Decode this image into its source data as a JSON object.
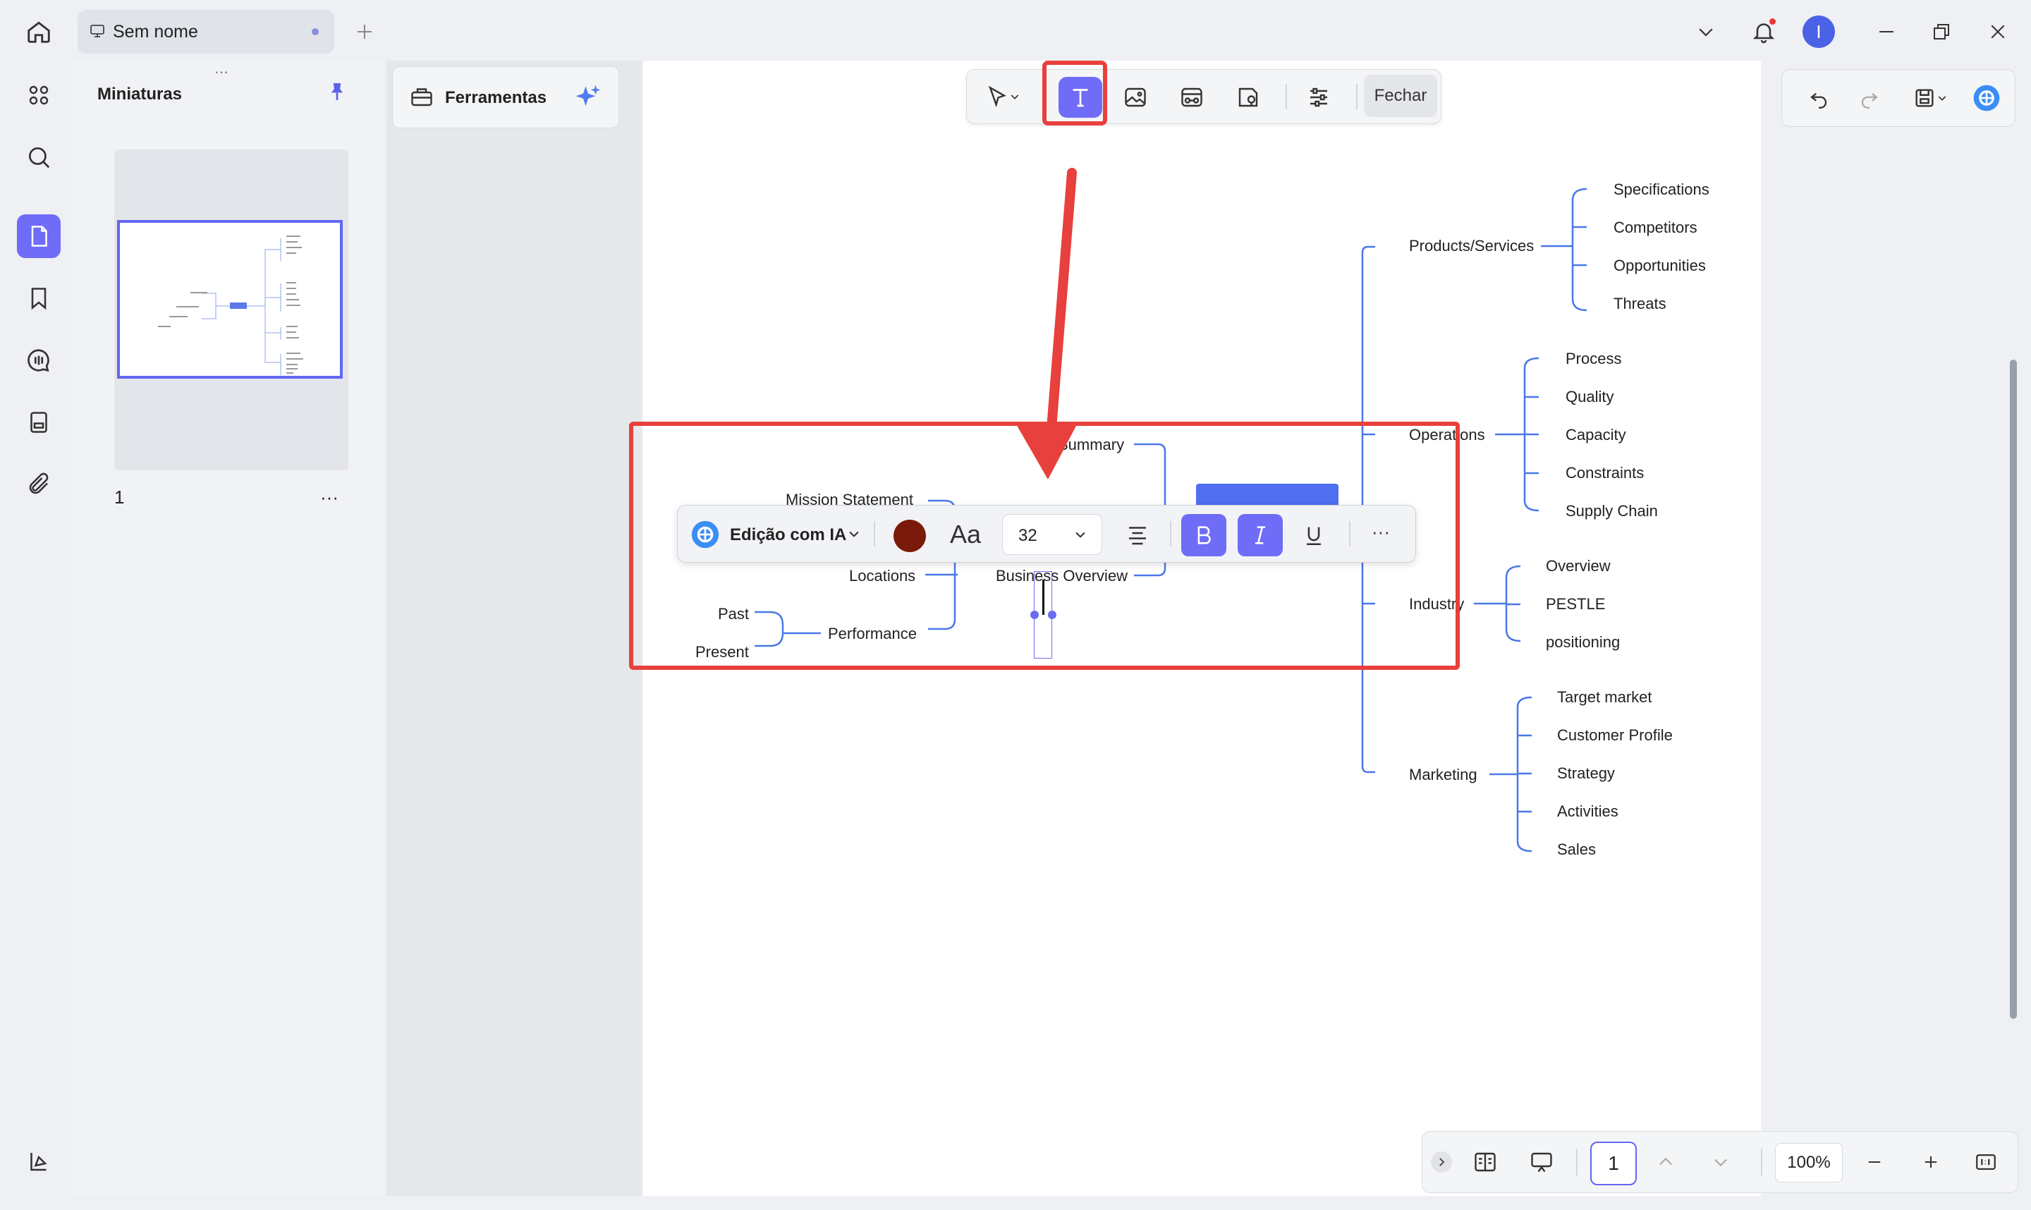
{
  "titlebar": {
    "tab_title": "Sem nome",
    "avatar_letter": "I"
  },
  "thumbnails": {
    "title": "Miniaturas",
    "page_number": "1",
    "more": "···"
  },
  "tools_panel": {
    "label": "Ferramentas"
  },
  "top_toolbar": {
    "close_label": "Fechar"
  },
  "format_bar": {
    "ai_edit_label": "Edição com IA",
    "font_icon_label": "Aa",
    "font_size": "32",
    "text_color": "#7a1a0a",
    "more": "···"
  },
  "mindmap": {
    "left": {
      "summary": "Summary",
      "mission": "Mission Statement",
      "locations": "Locations",
      "business_overview": "Business Overview",
      "past": "Past",
      "present": "Present",
      "performance": "Performance"
    },
    "right": {
      "products": {
        "label": "Products/Services",
        "children": [
          "Specifications",
          "Competitors",
          "Opportunities",
          "Threats"
        ]
      },
      "operations": {
        "label": "Operations",
        "children": [
          "Process",
          "Quality",
          "Capacity",
          "Constraints",
          "Supply Chain"
        ]
      },
      "industry": {
        "label": "Industry",
        "children": [
          "Overview",
          "PESTLE",
          "positioning"
        ]
      },
      "marketing": {
        "label": "Marketing",
        "children": [
          "Target market",
          "Customer Profile",
          "Strategy",
          "Activities",
          "Sales"
        ]
      }
    }
  },
  "statusbar": {
    "page": "1",
    "zoom": "100%"
  },
  "colors": {
    "accent": "#6f6cf7",
    "highlight_red": "#e8403c",
    "line_blue": "#4a78e8"
  }
}
